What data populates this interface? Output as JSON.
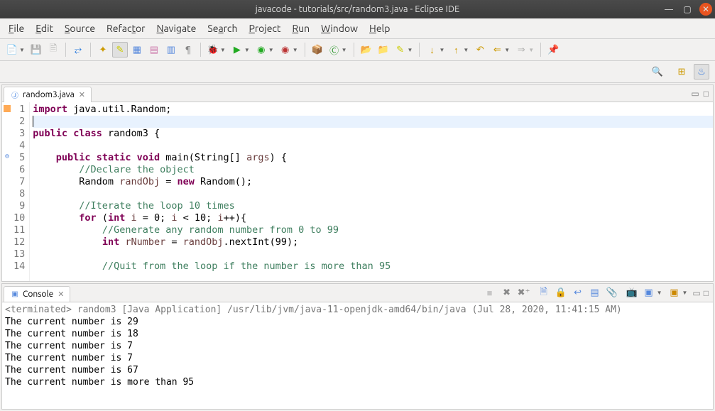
{
  "window": {
    "title": "javacode - tutorials/src/random3.java - Eclipse IDE"
  },
  "menu": {
    "file": "File",
    "edit": "Edit",
    "source": "Source",
    "refactor": "Refactor",
    "navigate": "Navigate",
    "search": "Search",
    "project": "Project",
    "run": "Run",
    "window": "Window",
    "help": "Help"
  },
  "tab": {
    "name": "random3.java"
  },
  "code": {
    "lines": [
      {
        "n": "1",
        "html": "<span class='kw'>import</span> java.util.Random;"
      },
      {
        "n": "2",
        "html": "<span class='caret'></span>",
        "hl": true
      },
      {
        "n": "3",
        "html": "<span class='kw'>public</span> <span class='kw'>class</span> random3 {"
      },
      {
        "n": "4",
        "html": ""
      },
      {
        "n": "5",
        "marker": "⊖",
        "html": "    <span class='kw'>public</span> <span class='kw'>static</span> <span class='kw'>void</span> main(String[] <span class='ident'>args</span>) {"
      },
      {
        "n": "6",
        "html": "        <span class='comment'>//Declare the object</span>"
      },
      {
        "n": "7",
        "html": "        Random <span class='ident'>randObj</span> = <span class='kw'>new</span> Random();"
      },
      {
        "n": "8",
        "html": ""
      },
      {
        "n": "9",
        "html": "        <span class='comment'>//Iterate the loop 10 times</span>"
      },
      {
        "n": "10",
        "html": "        <span class='kw'>for</span> (<span class='kw'>int</span> <span class='ident'>i</span> = 0; <span class='ident'>i</span> &lt; 10; <span class='ident'>i</span>++){"
      },
      {
        "n": "11",
        "html": "            <span class='comment'>//Generate any random number from 0 to 99</span>"
      },
      {
        "n": "12",
        "html": "            <span class='kw'>int</span> <span class='ident'>rNumber</span> = <span class='ident'>randObj</span>.nextInt(99);"
      },
      {
        "n": "13",
        "html": ""
      },
      {
        "n": "14",
        "html": "            <span class='comment'>//Quit from the loop if the number is more than 95</span>"
      }
    ]
  },
  "console": {
    "title": "Console",
    "header": "<terminated> random3 [Java Application] /usr/lib/jvm/java-11-openjdk-amd64/bin/java (Jul 28, 2020, 11:41:15 AM)",
    "lines": [
      "The current number is 29",
      "The current number is 18",
      "The current number is 7",
      "The current number is 7",
      "The current number is 67",
      "The current number is more than 95"
    ]
  }
}
